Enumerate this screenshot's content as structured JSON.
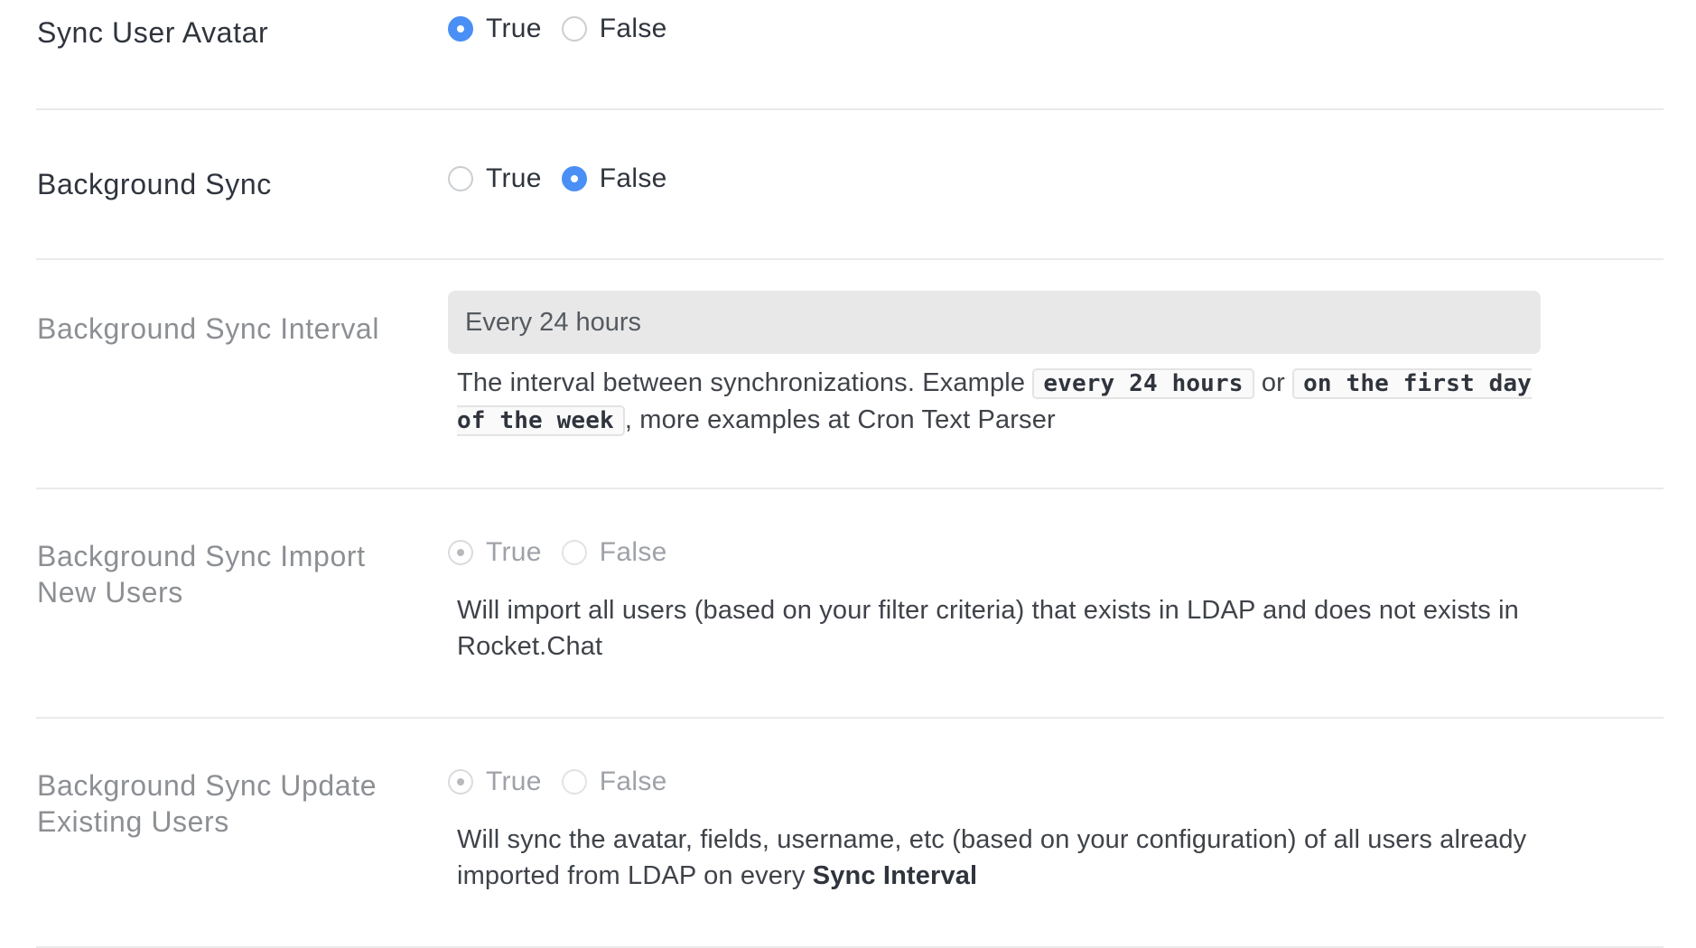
{
  "settings": [
    {
      "label": "Sync User Avatar",
      "true_label": "True",
      "false_label": "False",
      "value": true
    },
    {
      "label": "Background Sync",
      "true_label": "True",
      "false_label": "False",
      "value": false
    },
    {
      "label": "Background Sync Interval",
      "input_value": "Every 24 hours",
      "desc_before": "The interval between synchronizations. Example",
      "code1": "every 24 hours",
      "desc_or": "or",
      "code2": "on the first day of the week",
      "desc_after": ", more examples at Cron Text Parser"
    },
    {
      "label": "Background Sync Import New Users",
      "true_label": "True",
      "false_label": "False",
      "value": true,
      "disabled": true,
      "description": "Will import all users (based on your filter criteria) that exists in LDAP and does not exists in Rocket.Chat"
    },
    {
      "label": "Background Sync Update Existing Users",
      "true_label": "True",
      "false_label": "False",
      "value": true,
      "disabled": true,
      "desc_before": "Will sync the avatar, fields, username, etc (based on your configuration) of all users already imported from LDAP on every",
      "desc_bold": "Sync Interval"
    }
  ],
  "colors": {
    "accent": "#1d74f5",
    "divider": "#eaeaea",
    "input_bg": "#e8e8e8"
  }
}
